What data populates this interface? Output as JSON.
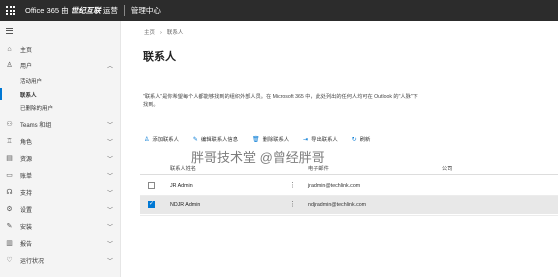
{
  "header": {
    "app_prefix": "Office 365 由",
    "brand": "世纪互联",
    "app_suffix": "运营",
    "admin_center": "管理中心"
  },
  "sidebar": {
    "items": [
      {
        "label": "主页",
        "icon": "home-icon"
      },
      {
        "label": "用户",
        "icon": "user-icon",
        "expanded": true
      },
      {
        "label": "Teams 和组",
        "icon": "teams-icon"
      },
      {
        "label": "角色",
        "icon": "role-icon"
      },
      {
        "label": "资源",
        "icon": "resource-icon"
      },
      {
        "label": "账单",
        "icon": "billing-icon"
      },
      {
        "label": "支持",
        "icon": "support-icon"
      },
      {
        "label": "设置",
        "icon": "settings-icon"
      },
      {
        "label": "安装",
        "icon": "setup-icon"
      },
      {
        "label": "报告",
        "icon": "reports-icon"
      },
      {
        "label": "运行状况",
        "icon": "health-icon"
      }
    ],
    "users_sub": [
      "活动用户",
      "联系人",
      "已删除的用户"
    ],
    "active_sub": "联系人"
  },
  "main": {
    "breadcrumb": [
      "主页",
      "联系人"
    ],
    "title": "联系人",
    "description": "\"联系人\"是你希望每个人都能够找到的组织外部人员。在 Microsoft 365 中，此处列出的任何人均可在 Outlook 的\"人脉\"下找到。",
    "toolbar": {
      "add": "添加联系人",
      "edit": "编辑联系人信息",
      "delete": "删除联系人",
      "export": "导出联系人",
      "refresh": "刷新"
    },
    "watermark": "胖哥技术堂 @曾经胖哥",
    "columns": {
      "name": "联系人姓名",
      "email": "电子邮件",
      "company": "公司"
    },
    "rows": [
      {
        "name": "JR Admin",
        "email": "jradmin@techlink.com",
        "checked": false
      },
      {
        "name": "NDJR Admin",
        "email": "ndjradmin@techlink.com",
        "checked": true
      }
    ]
  },
  "colors": {
    "accent": "#0078d4",
    "topbar": "#2c2c2c"
  }
}
